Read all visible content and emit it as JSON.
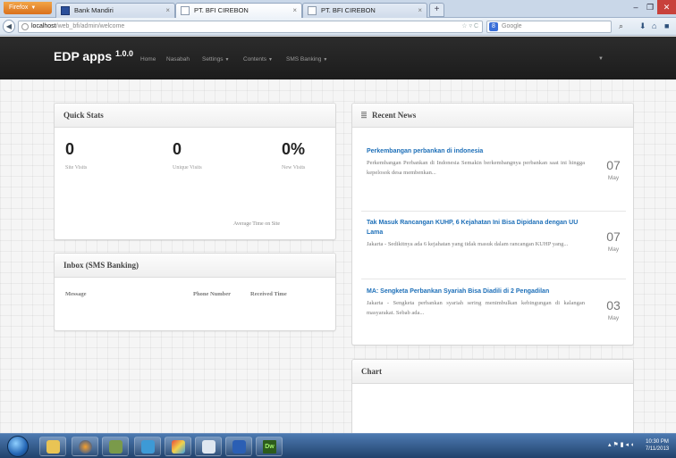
{
  "browser": {
    "firefox_label": "Firefox",
    "tabs": [
      {
        "title": "Bank Mandiri"
      },
      {
        "title": "PT. BFI CIREBON"
      },
      {
        "title": "PT. BFI CIREBON"
      }
    ],
    "new_tab": "+",
    "url_host": "localhost",
    "url_path": "/web_bfi/admin/welcome",
    "search_placeholder": "Google",
    "window_controls": {
      "min": "–",
      "max": "❐",
      "close": "✕"
    }
  },
  "app": {
    "brand": "EDP apps",
    "version": "1.0.0",
    "menu": [
      "Home",
      "Nasabah",
      "Settings",
      "Contents",
      "SMS Banking"
    ]
  },
  "quick_stats": {
    "title": "Quick Stats",
    "stats": [
      {
        "value": "0",
        "label": "Site Visits"
      },
      {
        "value": "0",
        "label": "Unique Visits"
      },
      {
        "value": "0%",
        "label": "New Visits"
      }
    ],
    "avg_time_label": "Average Time on Site"
  },
  "inbox": {
    "title": "Inbox (SMS Banking)",
    "columns": [
      "Message",
      "Phone Number",
      "Received Time"
    ]
  },
  "recent_news": {
    "title": "Recent News",
    "items": [
      {
        "title": "Perkembangan perbankan di indonesia",
        "body": "Perkembangan Perbankan di Indonesia Semakin berkembangnya perbankan saat ini hingga kepelosok desa membenkan...",
        "day": "07",
        "month": "May"
      },
      {
        "title": "Tak Masuk Rancangan KUHP, 6 Kejahatan Ini Bisa Dipidana dengan UU Lama",
        "body": "Jakarta - Sedikitnya ada 6 kejahatan yang tidak masuk dalam rancangan KUHP yang...",
        "day": "07",
        "month": "May"
      },
      {
        "title": "MA: Sengketa Perbankan Syariah Bisa Diadili di 2 Pengadilan",
        "body": "Jakarta - Sengketa perbankan syariah sering menimbulkan kebingungan di kalangan masyarakat. Sebab ada...",
        "day": "03",
        "month": "May"
      }
    ]
  },
  "chart_panel": {
    "title": "Chart"
  },
  "taskbar": {
    "clock_time": "10:30 PM",
    "clock_date": "7/11/2013",
    "dw_label": "Dw"
  }
}
